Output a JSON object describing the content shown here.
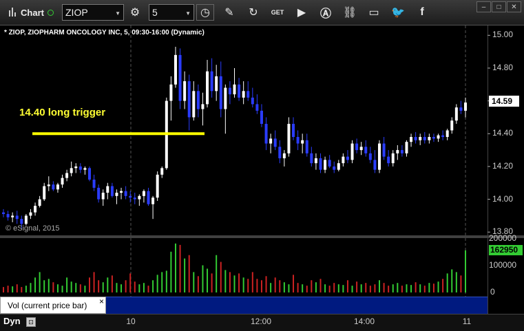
{
  "toolbar": {
    "app_label": "Chart",
    "symbol_value": "ZIOP",
    "interval_value": "5",
    "icons": [
      "gear-icon",
      "clock-icon",
      "pencil-icon",
      "refresh-icon",
      "get-icon",
      "play-icon",
      "a-icon",
      "link-icon",
      "comment-icon",
      "twitter-icon",
      "facebook-icon"
    ]
  },
  "window_controls": {
    "minimize": "–",
    "restore": "□",
    "close": "✕"
  },
  "price_pane": {
    "title": "* ZIOP, ZIOPHARM ONCOLOGY INC, 5, 09:30-16:00 (Dynamic)",
    "watermark": "© eSignal, 2015",
    "annotation": "14.40 long trigger",
    "last_price": "14.59",
    "y_ticks": [
      "15.00",
      "14.80",
      "14.60",
      "14.40",
      "14.20",
      "14.00",
      "13.80"
    ],
    "line_color": "#ffff00"
  },
  "volume_pane": {
    "y_ticks": [
      "200000",
      "100000",
      "0"
    ],
    "last_volume": "162950",
    "study_label": "Vol (current price bar)",
    "close_glyph": "×"
  },
  "x_axis": {
    "ticks": [
      "10",
      "12:00",
      "14:00",
      "11"
    ]
  },
  "bottom_bar": {
    "mode_label": "Dyn",
    "lock_icon": "lock-icon"
  },
  "chart_data": {
    "type": "candlestick",
    "ylim": [
      13.78,
      15.06
    ],
    "trigger_level": 14.4,
    "candles": [
      [
        13.92,
        13.94,
        13.89,
        13.91
      ],
      [
        13.91,
        13.93,
        13.87,
        13.89
      ],
      [
        13.89,
        13.92,
        13.86,
        13.9
      ],
      [
        13.9,
        13.93,
        13.85,
        13.88
      ],
      [
        13.88,
        13.9,
        13.82,
        13.85
      ],
      [
        13.85,
        13.91,
        13.84,
        13.9
      ],
      [
        13.9,
        13.94,
        13.88,
        13.92
      ],
      [
        13.92,
        13.98,
        13.9,
        13.96
      ],
      [
        13.96,
        14.02,
        13.95,
        14.0
      ],
      [
        14.0,
        14.1,
        13.99,
        14.08
      ],
      [
        14.08,
        14.14,
        14.05,
        14.09
      ],
      [
        14.09,
        14.11,
        14.05,
        14.06
      ],
      [
        14.06,
        14.1,
        14.04,
        14.09
      ],
      [
        14.09,
        14.15,
        14.07,
        14.13
      ],
      [
        14.13,
        14.18,
        14.11,
        14.16
      ],
      [
        14.16,
        14.23,
        14.14,
        14.19
      ],
      [
        14.19,
        14.22,
        14.16,
        14.2
      ],
      [
        14.2,
        14.22,
        14.16,
        14.18
      ],
      [
        14.18,
        14.2,
        14.15,
        14.19
      ],
      [
        14.19,
        14.2,
        14.11,
        14.12
      ],
      [
        14.12,
        14.15,
        14.05,
        14.07
      ],
      [
        14.07,
        14.09,
        13.98,
        14.0
      ],
      [
        14.0,
        14.06,
        13.96,
        14.04
      ],
      [
        14.04,
        14.1,
        14.0,
        14.08
      ],
      [
        14.08,
        14.1,
        14.01,
        14.02
      ],
      [
        14.02,
        14.06,
        13.97,
        14.04
      ],
      [
        14.04,
        14.07,
        14.0,
        14.05
      ],
      [
        14.05,
        14.08,
        14.0,
        14.02
      ],
      [
        14.02,
        14.05,
        13.98,
        14.01
      ],
      [
        14.01,
        14.04,
        13.97,
        14.0
      ],
      [
        14.0,
        14.03,
        13.96,
        14.02
      ],
      [
        14.02,
        14.06,
        13.98,
        14.05
      ],
      [
        14.05,
        14.07,
        13.96,
        13.97
      ],
      [
        13.97,
        14.02,
        13.88,
        14.01
      ],
      [
        14.01,
        14.17,
        13.99,
        14.15
      ],
      [
        14.15,
        14.2,
        14.13,
        14.19
      ],
      [
        14.19,
        14.62,
        14.18,
        14.6
      ],
      [
        14.6,
        14.75,
        14.48,
        14.7
      ],
      [
        14.7,
        14.93,
        14.68,
        14.88
      ],
      [
        14.88,
        14.92,
        14.55,
        14.6
      ],
      [
        14.6,
        14.78,
        14.55,
        14.72
      ],
      [
        14.72,
        14.76,
        14.42,
        14.5
      ],
      [
        14.5,
        14.72,
        14.48,
        14.66
      ],
      [
        14.66,
        14.7,
        14.5,
        14.55
      ],
      [
        14.55,
        14.65,
        14.45,
        14.58
      ],
      [
        14.58,
        14.85,
        14.56,
        14.78
      ],
      [
        14.78,
        14.86,
        14.62,
        14.66
      ],
      [
        14.66,
        14.82,
        14.6,
        14.75
      ],
      [
        14.75,
        14.84,
        14.5,
        14.55
      ],
      [
        14.55,
        14.7,
        14.4,
        14.68
      ],
      [
        14.68,
        14.72,
        14.58,
        14.64
      ],
      [
        14.64,
        14.8,
        14.62,
        14.7
      ],
      [
        14.7,
        14.74,
        14.6,
        14.62
      ],
      [
        14.62,
        14.72,
        14.58,
        14.66
      ],
      [
        14.66,
        14.72,
        14.6,
        14.62
      ],
      [
        14.62,
        14.68,
        14.56,
        14.58
      ],
      [
        14.58,
        14.64,
        14.52,
        14.54
      ],
      [
        14.54,
        14.58,
        14.44,
        14.46
      ],
      [
        14.46,
        14.5,
        14.3,
        14.34
      ],
      [
        14.34,
        14.4,
        14.28,
        14.37
      ],
      [
        14.37,
        14.42,
        14.3,
        14.32
      ],
      [
        14.32,
        14.36,
        14.22,
        14.25
      ],
      [
        14.25,
        14.3,
        14.2,
        14.28
      ],
      [
        14.28,
        14.5,
        14.26,
        14.46
      ],
      [
        14.46,
        14.5,
        14.36,
        14.38
      ],
      [
        14.38,
        14.42,
        14.3,
        14.34
      ],
      [
        14.34,
        14.4,
        14.28,
        14.36
      ],
      [
        14.36,
        14.4,
        14.26,
        14.28
      ],
      [
        14.28,
        14.32,
        14.2,
        14.22
      ],
      [
        14.22,
        14.28,
        14.18,
        14.25
      ],
      [
        14.25,
        14.28,
        14.16,
        14.18
      ],
      [
        14.18,
        14.26,
        14.16,
        14.24
      ],
      [
        14.24,
        14.27,
        14.19,
        14.2
      ],
      [
        14.2,
        14.23,
        14.16,
        14.18
      ],
      [
        14.18,
        14.24,
        14.17,
        14.22
      ],
      [
        14.22,
        14.28,
        14.2,
        14.26
      ],
      [
        14.26,
        14.3,
        14.22,
        14.24
      ],
      [
        14.24,
        14.36,
        14.22,
        14.34
      ],
      [
        14.34,
        14.37,
        14.28,
        14.3
      ],
      [
        14.3,
        14.35,
        14.27,
        14.32
      ],
      [
        14.32,
        14.36,
        14.26,
        14.28
      ],
      [
        14.28,
        14.32,
        14.22,
        14.24
      ],
      [
        14.24,
        14.3,
        14.16,
        14.18
      ],
      [
        14.18,
        14.36,
        14.16,
        14.34
      ],
      [
        14.34,
        14.38,
        14.24,
        14.26
      ],
      [
        14.26,
        14.3,
        14.2,
        14.22
      ],
      [
        14.22,
        14.3,
        14.2,
        14.28
      ],
      [
        14.28,
        14.33,
        14.24,
        14.3
      ],
      [
        14.3,
        14.33,
        14.26,
        14.28
      ],
      [
        14.28,
        14.36,
        14.26,
        14.35
      ],
      [
        14.35,
        14.4,
        14.32,
        14.38
      ],
      [
        14.38,
        14.41,
        14.34,
        14.36
      ],
      [
        14.36,
        14.4,
        14.33,
        14.38
      ],
      [
        14.38,
        14.41,
        14.34,
        14.36
      ],
      [
        14.36,
        14.4,
        14.34,
        14.38
      ],
      [
        14.38,
        14.4,
        14.35,
        14.37
      ],
      [
        14.37,
        14.4,
        14.35,
        14.39
      ],
      [
        14.39,
        14.42,
        14.36,
        14.38
      ],
      [
        14.38,
        14.43,
        14.36,
        14.42
      ],
      [
        14.42,
        14.5,
        14.4,
        14.48
      ],
      [
        14.48,
        14.58,
        14.46,
        14.56
      ],
      [
        14.56,
        14.6,
        14.52,
        14.54
      ],
      [
        14.54,
        14.62,
        14.5,
        14.59
      ]
    ],
    "volume": [
      8,
      10,
      9,
      12,
      8,
      10,
      14,
      22,
      30,
      18,
      20,
      15,
      12,
      10,
      22,
      16,
      14,
      12,
      10,
      22,
      30,
      18,
      15,
      22,
      25,
      14,
      12,
      18,
      28,
      16,
      12,
      14,
      10,
      18,
      26,
      30,
      32,
      60,
      72,
      70,
      50,
      55,
      30,
      24,
      40,
      35,
      28,
      55,
      45,
      33,
      30,
      25,
      28,
      22,
      20,
      30,
      20,
      18,
      24,
      14,
      22,
      18,
      15,
      12,
      26,
      14,
      12,
      10,
      18,
      15,
      20,
      12,
      10,
      14,
      12,
      11,
      18,
      10,
      16,
      12,
      14,
      10,
      12,
      18,
      14,
      10,
      12,
      14,
      10,
      12,
      11,
      15,
      12,
      10,
      14,
      13,
      16,
      20,
      28,
      34,
      30,
      25,
      62
    ]
  }
}
